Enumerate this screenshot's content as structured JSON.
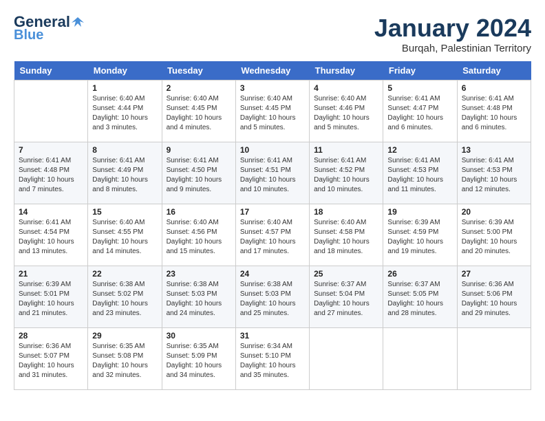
{
  "header": {
    "logo_line1": "General",
    "logo_line2": "Blue",
    "month_title": "January 2024",
    "location": "Burqah, Palestinian Territory"
  },
  "columns": [
    "Sunday",
    "Monday",
    "Tuesday",
    "Wednesday",
    "Thursday",
    "Friday",
    "Saturday"
  ],
  "weeks": [
    [
      {
        "day": "",
        "sunrise": "",
        "sunset": "",
        "daylight": ""
      },
      {
        "day": "1",
        "sunrise": "Sunrise: 6:40 AM",
        "sunset": "Sunset: 4:44 PM",
        "daylight": "Daylight: 10 hours and 3 minutes."
      },
      {
        "day": "2",
        "sunrise": "Sunrise: 6:40 AM",
        "sunset": "Sunset: 4:45 PM",
        "daylight": "Daylight: 10 hours and 4 minutes."
      },
      {
        "day": "3",
        "sunrise": "Sunrise: 6:40 AM",
        "sunset": "Sunset: 4:45 PM",
        "daylight": "Daylight: 10 hours and 5 minutes."
      },
      {
        "day": "4",
        "sunrise": "Sunrise: 6:40 AM",
        "sunset": "Sunset: 4:46 PM",
        "daylight": "Daylight: 10 hours and 5 minutes."
      },
      {
        "day": "5",
        "sunrise": "Sunrise: 6:41 AM",
        "sunset": "Sunset: 4:47 PM",
        "daylight": "Daylight: 10 hours and 6 minutes."
      },
      {
        "day": "6",
        "sunrise": "Sunrise: 6:41 AM",
        "sunset": "Sunset: 4:48 PM",
        "daylight": "Daylight: 10 hours and 6 minutes."
      }
    ],
    [
      {
        "day": "7",
        "sunrise": "Sunrise: 6:41 AM",
        "sunset": "Sunset: 4:48 PM",
        "daylight": "Daylight: 10 hours and 7 minutes."
      },
      {
        "day": "8",
        "sunrise": "Sunrise: 6:41 AM",
        "sunset": "Sunset: 4:49 PM",
        "daylight": "Daylight: 10 hours and 8 minutes."
      },
      {
        "day": "9",
        "sunrise": "Sunrise: 6:41 AM",
        "sunset": "Sunset: 4:50 PM",
        "daylight": "Daylight: 10 hours and 9 minutes."
      },
      {
        "day": "10",
        "sunrise": "Sunrise: 6:41 AM",
        "sunset": "Sunset: 4:51 PM",
        "daylight": "Daylight: 10 hours and 10 minutes."
      },
      {
        "day": "11",
        "sunrise": "Sunrise: 6:41 AM",
        "sunset": "Sunset: 4:52 PM",
        "daylight": "Daylight: 10 hours and 10 minutes."
      },
      {
        "day": "12",
        "sunrise": "Sunrise: 6:41 AM",
        "sunset": "Sunset: 4:53 PM",
        "daylight": "Daylight: 10 hours and 11 minutes."
      },
      {
        "day": "13",
        "sunrise": "Sunrise: 6:41 AM",
        "sunset": "Sunset: 4:53 PM",
        "daylight": "Daylight: 10 hours and 12 minutes."
      }
    ],
    [
      {
        "day": "14",
        "sunrise": "Sunrise: 6:41 AM",
        "sunset": "Sunset: 4:54 PM",
        "daylight": "Daylight: 10 hours and 13 minutes."
      },
      {
        "day": "15",
        "sunrise": "Sunrise: 6:40 AM",
        "sunset": "Sunset: 4:55 PM",
        "daylight": "Daylight: 10 hours and 14 minutes."
      },
      {
        "day": "16",
        "sunrise": "Sunrise: 6:40 AM",
        "sunset": "Sunset: 4:56 PM",
        "daylight": "Daylight: 10 hours and 15 minutes."
      },
      {
        "day": "17",
        "sunrise": "Sunrise: 6:40 AM",
        "sunset": "Sunset: 4:57 PM",
        "daylight": "Daylight: 10 hours and 17 minutes."
      },
      {
        "day": "18",
        "sunrise": "Sunrise: 6:40 AM",
        "sunset": "Sunset: 4:58 PM",
        "daylight": "Daylight: 10 hours and 18 minutes."
      },
      {
        "day": "19",
        "sunrise": "Sunrise: 6:39 AM",
        "sunset": "Sunset: 4:59 PM",
        "daylight": "Daylight: 10 hours and 19 minutes."
      },
      {
        "day": "20",
        "sunrise": "Sunrise: 6:39 AM",
        "sunset": "Sunset: 5:00 PM",
        "daylight": "Daylight: 10 hours and 20 minutes."
      }
    ],
    [
      {
        "day": "21",
        "sunrise": "Sunrise: 6:39 AM",
        "sunset": "Sunset: 5:01 PM",
        "daylight": "Daylight: 10 hours and 21 minutes."
      },
      {
        "day": "22",
        "sunrise": "Sunrise: 6:38 AM",
        "sunset": "Sunset: 5:02 PM",
        "daylight": "Daylight: 10 hours and 23 minutes."
      },
      {
        "day": "23",
        "sunrise": "Sunrise: 6:38 AM",
        "sunset": "Sunset: 5:03 PM",
        "daylight": "Daylight: 10 hours and 24 minutes."
      },
      {
        "day": "24",
        "sunrise": "Sunrise: 6:38 AM",
        "sunset": "Sunset: 5:03 PM",
        "daylight": "Daylight: 10 hours and 25 minutes."
      },
      {
        "day": "25",
        "sunrise": "Sunrise: 6:37 AM",
        "sunset": "Sunset: 5:04 PM",
        "daylight": "Daylight: 10 hours and 27 minutes."
      },
      {
        "day": "26",
        "sunrise": "Sunrise: 6:37 AM",
        "sunset": "Sunset: 5:05 PM",
        "daylight": "Daylight: 10 hours and 28 minutes."
      },
      {
        "day": "27",
        "sunrise": "Sunrise: 6:36 AM",
        "sunset": "Sunset: 5:06 PM",
        "daylight": "Daylight: 10 hours and 29 minutes."
      }
    ],
    [
      {
        "day": "28",
        "sunrise": "Sunrise: 6:36 AM",
        "sunset": "Sunset: 5:07 PM",
        "daylight": "Daylight: 10 hours and 31 minutes."
      },
      {
        "day": "29",
        "sunrise": "Sunrise: 6:35 AM",
        "sunset": "Sunset: 5:08 PM",
        "daylight": "Daylight: 10 hours and 32 minutes."
      },
      {
        "day": "30",
        "sunrise": "Sunrise: 6:35 AM",
        "sunset": "Sunset: 5:09 PM",
        "daylight": "Daylight: 10 hours and 34 minutes."
      },
      {
        "day": "31",
        "sunrise": "Sunrise: 6:34 AM",
        "sunset": "Sunset: 5:10 PM",
        "daylight": "Daylight: 10 hours and 35 minutes."
      },
      {
        "day": "",
        "sunrise": "",
        "sunset": "",
        "daylight": ""
      },
      {
        "day": "",
        "sunrise": "",
        "sunset": "",
        "daylight": ""
      },
      {
        "day": "",
        "sunrise": "",
        "sunset": "",
        "daylight": ""
      }
    ]
  ]
}
